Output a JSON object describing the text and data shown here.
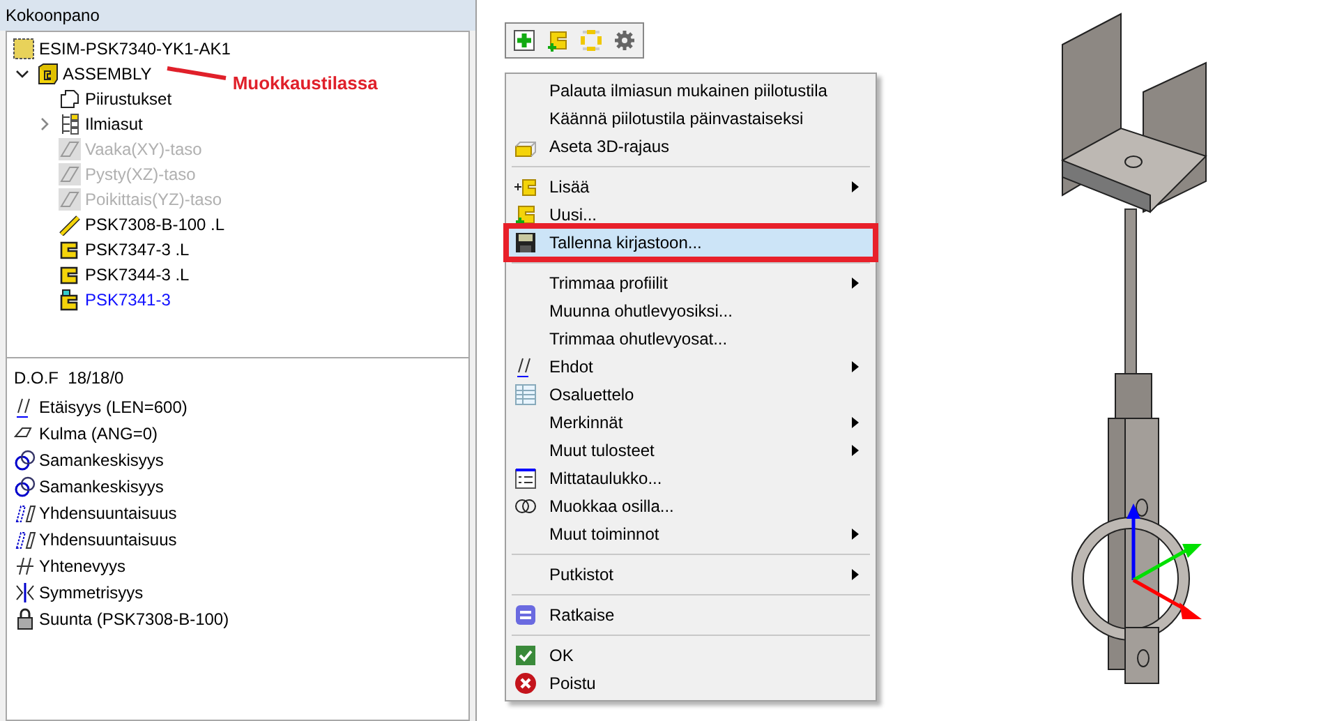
{
  "panel": {
    "title": "Kokoonpano"
  },
  "tree": [
    {
      "label": "ESIM-PSK7340-YK1-AK1",
      "kind": "root",
      "disabled": false,
      "active": false,
      "children": [
        {
          "label": "ASSEMBLY",
          "kind": "assembly",
          "expanded": true,
          "disabled": false,
          "active": false,
          "annotation": "Muokkaustilassa",
          "children": [
            {
              "label": "Piirustukset",
              "kind": "drawings",
              "disabled": false,
              "active": false
            },
            {
              "label": "Ilmiasut",
              "kind": "appearances",
              "expanded": false,
              "disabled": false,
              "active": false
            },
            {
              "label": "Vaaka(XY)-taso",
              "kind": "plane",
              "disabled": true,
              "active": false
            },
            {
              "label": "Pysty(XZ)-taso",
              "kind": "plane",
              "disabled": true,
              "active": false
            },
            {
              "label": "Poikittais(YZ)-taso",
              "kind": "plane",
              "disabled": true,
              "active": false
            },
            {
              "label": "PSK7308-B-100 .L",
              "kind": "rod",
              "disabled": false,
              "active": false
            },
            {
              "label": "PSK7347-3 .L",
              "kind": "part",
              "disabled": false,
              "active": false
            },
            {
              "label": "PSK7344-3 .L",
              "kind": "part",
              "disabled": false,
              "active": false
            },
            {
              "label": "PSK7341-3",
              "kind": "part-edit",
              "disabled": false,
              "active": true
            }
          ]
        }
      ]
    }
  ],
  "dof": "D.O.F  18/18/0",
  "constraints": [
    {
      "label": "Etäisyys (LEN=600)",
      "kind": "distance"
    },
    {
      "label": "Kulma (ANG=0)",
      "kind": "angle"
    },
    {
      "label": "Samankeskisyys",
      "kind": "concentric"
    },
    {
      "label": "Samankeskisyys",
      "kind": "concentric"
    },
    {
      "label": "Yhdensuuntaisuus",
      "kind": "parallel"
    },
    {
      "label": "Yhdensuuntaisuus",
      "kind": "parallel"
    },
    {
      "label": "Yhtenevyys",
      "kind": "coincident"
    },
    {
      "label": "Symmetrisyys",
      "kind": "symmetry"
    },
    {
      "label": "Suunta (PSK7308-B-100)",
      "kind": "lock"
    }
  ],
  "toolbar": [
    {
      "kind": "add"
    },
    {
      "kind": "new-part"
    },
    {
      "kind": "frame"
    },
    {
      "kind": "settings"
    }
  ],
  "menu": [
    {
      "kind": "item",
      "label": "Palauta ilmiasun mukainen piilotustila",
      "submenu": false,
      "selected": false,
      "marked": false
    },
    {
      "kind": "item",
      "label": "Käännä piilotustila päinvastaiseksi",
      "submenu": false,
      "selected": false,
      "marked": false
    },
    {
      "kind": "box3d",
      "label": "Aseta 3D-rajaus",
      "submenu": false,
      "selected": false,
      "marked": false
    },
    {
      "kind": "separator"
    },
    {
      "kind": "insert",
      "label": "Lisää",
      "submenu": true,
      "selected": false,
      "marked": false
    },
    {
      "kind": "new-part",
      "label": "Uusi...",
      "submenu": false,
      "selected": false,
      "marked": false
    },
    {
      "kind": "save",
      "label": "Tallenna kirjastoon...",
      "submenu": false,
      "selected": true,
      "marked": true
    },
    {
      "kind": "separator"
    },
    {
      "kind": "item",
      "label": "Trimmaa profiilit",
      "submenu": true,
      "selected": false,
      "marked": false
    },
    {
      "kind": "item",
      "label": "Muunna ohutlevyosiksi...",
      "submenu": false,
      "selected": false,
      "marked": false
    },
    {
      "kind": "item",
      "label": "Trimmaa ohutlevyosat...",
      "submenu": false,
      "selected": false,
      "marked": false
    },
    {
      "kind": "constraint",
      "label": "Ehdot",
      "submenu": true,
      "selected": false,
      "marked": false
    },
    {
      "kind": "table",
      "label": "Osaluettelo",
      "submenu": false,
      "selected": false,
      "marked": false
    },
    {
      "kind": "item",
      "label": "Merkinnät",
      "submenu": true,
      "selected": false,
      "marked": false
    },
    {
      "kind": "item",
      "label": "Muut tulosteet",
      "submenu": true,
      "selected": false,
      "marked": false
    },
    {
      "kind": "list",
      "label": "Mittataulukko...",
      "submenu": false,
      "selected": false,
      "marked": false
    },
    {
      "kind": "rings",
      "label": "Muokkaa osilla...",
      "submenu": false,
      "selected": false,
      "marked": false
    },
    {
      "kind": "item",
      "label": "Muut toiminnot",
      "submenu": true,
      "selected": false,
      "marked": false
    },
    {
      "kind": "separator"
    },
    {
      "kind": "item",
      "label": "Putkistot",
      "submenu": true,
      "selected": false,
      "marked": false
    },
    {
      "kind": "separator"
    },
    {
      "kind": "solve",
      "label": "Ratkaise",
      "submenu": false,
      "selected": false,
      "marked": false
    },
    {
      "kind": "separator"
    },
    {
      "kind": "ok",
      "label": "OK",
      "submenu": false,
      "selected": false,
      "marked": false
    },
    {
      "kind": "cancel",
      "label": "Poistu",
      "submenu": false,
      "selected": false,
      "marked": false
    }
  ]
}
